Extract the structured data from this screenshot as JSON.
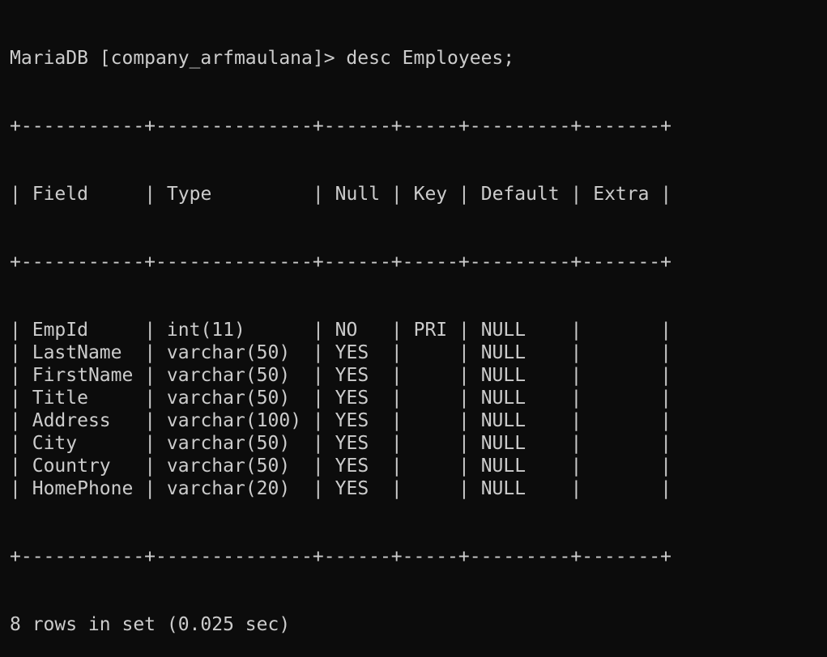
{
  "terminal": {
    "prompt": "MariaDB [company_arfmaulana]> ",
    "command": "desc Employees;",
    "border": "+-----------+--------------+------+-----+---------+-------+",
    "header": {
      "field": "Field",
      "type": "Type",
      "null": "Null",
      "key": "Key",
      "default": "Default",
      "extra": "Extra"
    },
    "rows": [
      {
        "field": "EmpId",
        "type": "int(11)",
        "null": "NO",
        "key": "PRI",
        "default": "NULL",
        "extra": ""
      },
      {
        "field": "LastName",
        "type": "varchar(50)",
        "null": "YES",
        "key": "",
        "default": "NULL",
        "extra": ""
      },
      {
        "field": "FirstName",
        "type": "varchar(50)",
        "null": "YES",
        "key": "",
        "default": "NULL",
        "extra": ""
      },
      {
        "field": "Title",
        "type": "varchar(50)",
        "null": "YES",
        "key": "",
        "default": "NULL",
        "extra": ""
      },
      {
        "field": "Address",
        "type": "varchar(100)",
        "null": "YES",
        "key": "",
        "default": "NULL",
        "extra": ""
      },
      {
        "field": "City",
        "type": "varchar(50)",
        "null": "YES",
        "key": "",
        "default": "NULL",
        "extra": ""
      },
      {
        "field": "Country",
        "type": "varchar(50)",
        "null": "YES",
        "key": "",
        "default": "NULL",
        "extra": ""
      },
      {
        "field": "HomePhone",
        "type": "varchar(20)",
        "null": "YES",
        "key": "",
        "default": "NULL",
        "extra": ""
      }
    ],
    "summary": "8 rows in set (0.025 sec)"
  }
}
